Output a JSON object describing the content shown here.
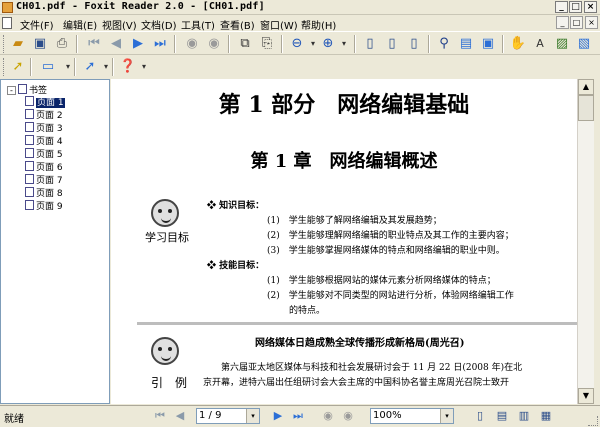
{
  "window": {
    "title": "CH01.pdf - Foxit Reader 2.0 - [CH01.pdf]",
    "min": "_",
    "max": "□",
    "close": "×"
  },
  "menu": [
    "文件(F)",
    "编辑(E)",
    "视图(V)",
    "文档(D)",
    "工具(T)",
    "查看(B)",
    "窗口(W)",
    "帮助(H)"
  ],
  "mdi": {
    "min": "_",
    "restore": "□",
    "close": "×"
  },
  "toolbar": {
    "icons": [
      "open-icon",
      "save-icon",
      "print-icon",
      "first-page-icon",
      "prev-page-icon",
      "next-page-icon",
      "last-page-icon",
      "back-icon",
      "forward-icon",
      "copy-icon",
      "paste-icon",
      "zoom-out-icon",
      "zoom-in-icon",
      "single-page-icon",
      "continuous-icon",
      "facing-icon",
      "find-icon",
      "bookmark-panel-icon",
      "thumbnail-icon",
      "hand-tool-icon",
      "text-select-icon",
      "snapshot-icon"
    ]
  },
  "sidebar": {
    "root": "书签",
    "items": [
      "页面 1",
      "页面 2",
      "页面 3",
      "页面 4",
      "页面 5",
      "页面 6",
      "页面 7",
      "页面 8",
      "页面 9"
    ],
    "selected": 0
  },
  "document": {
    "part_title": "第 1 部分　网络编辑基础",
    "chapter_title": "第 1 章　网络编辑概述",
    "goals_label": "学习目标",
    "knowledge_head": "知识目标：",
    "knowledge": [
      "(1)　学生能够了解网络编辑及其发展趋势；",
      "(2)　学生能够理解网络编辑的职业特点及其工作的主要内容；",
      "(3)　学生能够掌握网络媒体的特点和网络编辑的职业中则。"
    ],
    "skill_head": "技能目标：",
    "skills": [
      "(1)　学生能够根据网站的媒体元素分析网络媒体的特点；",
      "(2)　学生能够对不同类型的网站进行分析，体验网络编辑工作",
      "的特点。"
    ],
    "example_label": "引　例",
    "article_title": "网络媒体日趋成熟全球传播形成新格局(周光召)",
    "body": [
      "第六届亚太地区媒体与科技和社会发展研讨会于 11 月 22 日(2008 年)在北",
      "京开幕，进特六届出任组研讨会大会主席的中国科协名誉主席周光召院士致开"
    ]
  },
  "statusbar": {
    "status": "就绪",
    "page": "1 / 9",
    "zoom": "100%"
  }
}
